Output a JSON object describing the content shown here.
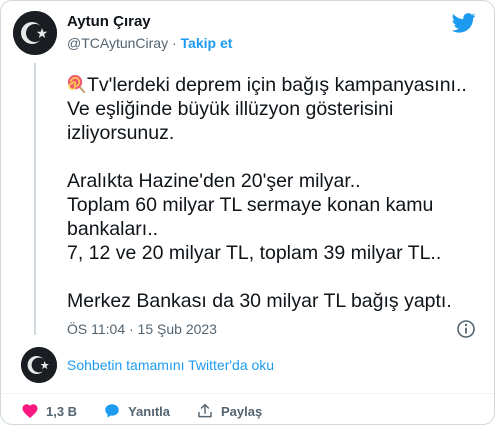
{
  "tweet": {
    "author_name": "Aytun Çıray",
    "handle": "@TCAytunCiray",
    "separator": " · ",
    "follow_label": "Takip et",
    "body_lines": [
      "Tv'lerdeki deprem  için bağış kampanyasını..",
      "Ve eşliğinde büyük illüzyon gösterisini",
      "izliyorsunuz.",
      "",
      "Aralıkta Hazine'den 20'şer milyar..",
      "Toplam 60 milyar TL sermaye konan kamu",
      "bankaları..",
      "7, 12 ve 20 milyar TL, toplam 39 milyar TL..",
      "",
      "Merkez Bankası da 30 milyar TL bağış yaptı."
    ],
    "timestamp": "ÖS 11:04 · 15 Şub 2023",
    "read_thread_label": "Sohbetin tamamını Twitter'da oku",
    "actions": {
      "like_count": "1,3 B",
      "reply_label": "Yanıtla",
      "share_label": "Paylaş"
    }
  },
  "colors": {
    "accent": "#1d9bf0",
    "like": "#f91880",
    "muted": "#536471",
    "avatar_bg": "#1a1d21"
  },
  "icons": [
    "crescent-star-avatar-icon",
    "twitter-bird-icon",
    "lollipop-emoji-icon",
    "info-icon",
    "heart-icon",
    "reply-bubble-icon",
    "share-icon"
  ]
}
